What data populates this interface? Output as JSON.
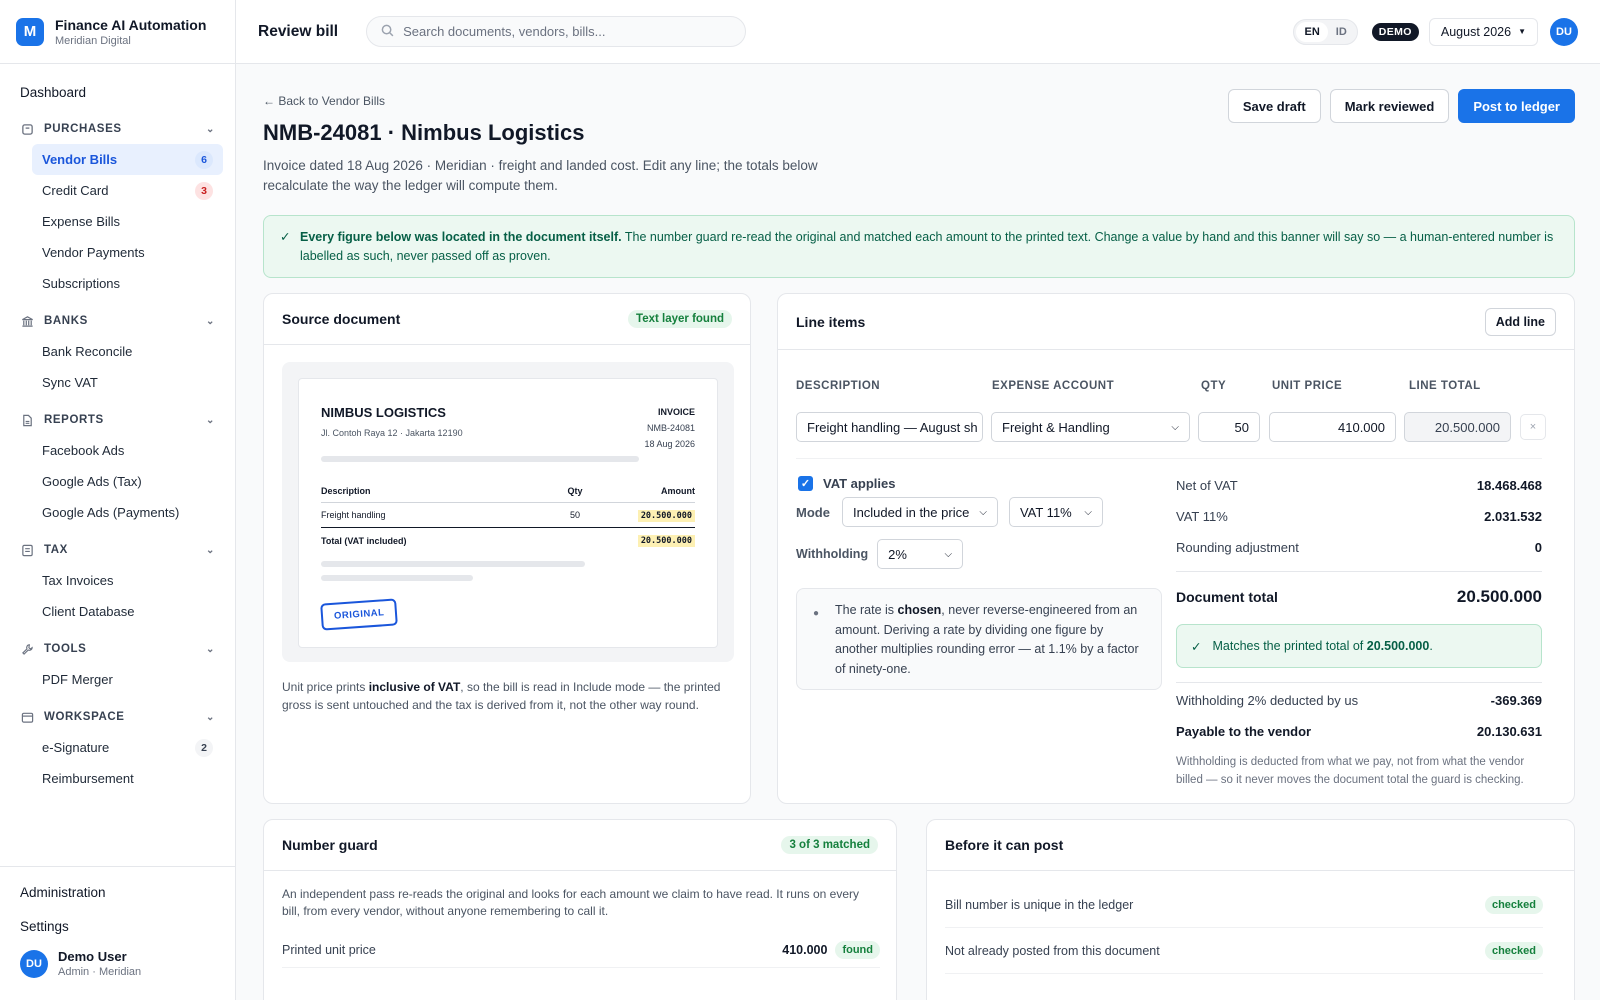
{
  "brand": {
    "logo": "M",
    "name": "Finance AI Automation",
    "org": "Meridian Digital"
  },
  "nav": {
    "dashboard": "Dashboard",
    "sections": [
      {
        "icon": "purchases-icon",
        "title": "PURCHASES",
        "items": [
          {
            "label": "Vendor Bills",
            "badge": "6",
            "active": true
          },
          {
            "label": "Credit Card",
            "badge": "3"
          },
          {
            "label": "Expense Bills"
          },
          {
            "label": "Vendor Payments"
          },
          {
            "label": "Subscriptions"
          }
        ]
      },
      {
        "icon": "bank-icon",
        "title": "BANKS",
        "items": [
          {
            "label": "Bank Reconcile"
          },
          {
            "label": "Sync VAT"
          }
        ]
      },
      {
        "icon": "reports-icon",
        "title": "REPORTS",
        "items": [
          {
            "label": "Facebook Ads"
          },
          {
            "label": "Google Ads (Tax)"
          },
          {
            "label": "Google Ads (Payments)"
          }
        ]
      },
      {
        "icon": "tax-icon",
        "title": "TAX",
        "items": [
          {
            "label": "Tax Invoices"
          },
          {
            "label": "Client Database"
          }
        ]
      },
      {
        "icon": "tools-icon",
        "title": "TOOLS",
        "items": [
          {
            "label": "PDF Merger"
          }
        ]
      },
      {
        "icon": "workspace-icon",
        "title": "WORKSPACE",
        "items": [
          {
            "label": "e-Signature",
            "badge": "2"
          },
          {
            "label": "Reimbursement"
          }
        ]
      }
    ],
    "administration": "Administration",
    "settings": "Settings"
  },
  "user": {
    "initials": "DU",
    "name": "Demo User",
    "sub": "Admin · Meridian"
  },
  "header": {
    "title": "Review bill",
    "search_placeholder": "Search documents, vendors, bills...",
    "lang_en": "EN",
    "lang_id": "ID",
    "demo": "DEMO",
    "period": "August 2026",
    "avatar": "DU"
  },
  "page": {
    "back": "← Back to Vendor Bills",
    "title": "NMB-24081 · Nimbus Logistics",
    "subtitle": "Invoice dated 18 Aug 2026 · Meridian · freight and landed cost. Edit any line; the totals below recalculate the way the ledger will compute them.",
    "save_draft": "Save draft",
    "mark_reviewed": "Mark reviewed",
    "post": "Post to ledger"
  },
  "banner": {
    "bold": "Every figure below was located in the document itself.",
    "text": " The number guard re-read the original and matched each amount to the printed text. Change a value by hand and this banner will say so — a human-entered number is labelled as such, never passed off as proven."
  },
  "source": {
    "title": "Source document",
    "pill": "Text layer found",
    "vendor": "NIMBUS LOGISTICS",
    "address": "Jl. Contoh Raya 12 · Jakarta 12190",
    "inv_label": "INVOICE",
    "inv_no": "NMB-24081",
    "inv_date": "18 Aug 2026",
    "col_desc": "Description",
    "col_qty": "Qty",
    "col_amount": "Amount",
    "row_desc": "Freight handling",
    "row_qty": "50",
    "row_amount": "20.500.000",
    "total_label": "Total (VAT included)",
    "total_amount": "20.500.000",
    "stamp": "ORIGINAL",
    "note_pre": "Unit price prints ",
    "note_bold": "inclusive of VAT",
    "note_post": ", so the bill is read in Include mode — the printed gross is sent untouched and the tax is derived from it, not the other way round."
  },
  "lines": {
    "title": "Line items",
    "add": "Add line",
    "col_desc": "DESCRIPTION",
    "col_account": "EXPENSE ACCOUNT",
    "col_qty": "QTY",
    "col_unit": "UNIT PRICE",
    "col_total": "LINE TOTAL",
    "desc": "Freight handling — August sh",
    "account": "Freight & Handling",
    "qty": "50",
    "unit": "410.000",
    "total": "20.500.000",
    "remove": "×",
    "vat_applies": "VAT applies",
    "mode_label": "Mode",
    "mode_value": "Included in the price",
    "vat_value": "VAT 11%",
    "withholding_label": "Withholding",
    "withholding_value": "2%",
    "rate_pre": "The rate is ",
    "rate_bold": "chosen",
    "rate_post": ", never reverse-engineered from an amount. Deriving a rate by dividing one figure by another multiplies rounding error — at 1.1% by a factor of ninety-one."
  },
  "totals": {
    "net_label": "Net of VAT",
    "net": "18.468.468",
    "vat_label": "VAT 11%",
    "vat": "2.031.532",
    "round_label": "Rounding adjustment",
    "round": "0",
    "doc_label": "Document total",
    "doc": "20.500.000",
    "match_pre": "Matches the printed total of ",
    "match_bold": "20.500.000",
    "match_post": ".",
    "wh_label": "Withholding 2% deducted by us",
    "wh": "-369.369",
    "pay_label": "Payable to the vendor",
    "pay": "20.130.631",
    "wh_note": "Withholding is deducted from what we pay, not from what the vendor billed — so it never moves the document total the guard is checking."
  },
  "guard": {
    "title": "Number guard",
    "pill": "3 of 3 matched",
    "intro": "An independent pass re-reads the original and looks for each amount we claim to have read. It runs on every bill, from every vendor, without anyone remembering to call it.",
    "rows": [
      {
        "label": "Printed unit price",
        "value": "410.000",
        "status": "found"
      }
    ]
  },
  "post_checks": {
    "title": "Before it can post",
    "rows": [
      {
        "label": "Bill number is unique in the ledger",
        "status": "checked"
      },
      {
        "label": "Not already posted from this document",
        "status": "checked"
      }
    ]
  }
}
